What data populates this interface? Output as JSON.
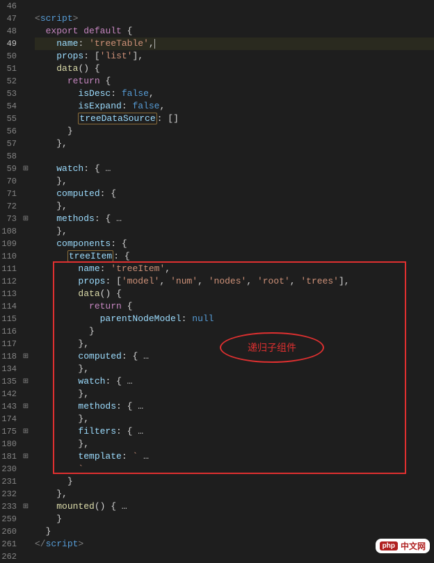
{
  "lines": [
    {
      "num": "46",
      "fold": "",
      "html": ""
    },
    {
      "num": "47",
      "fold": "",
      "html": "<span class='tag'>&lt;</span><span class='tagname'>script</span><span class='tag'>&gt;</span>"
    },
    {
      "num": "48",
      "fold": "",
      "html": "  <span class='kw-ctrl'>export</span> <span class='kw-ctrl'>default</span> <span class='brace'>{</span>"
    },
    {
      "num": "49",
      "fold": "",
      "hl": true,
      "html": "    <span class='prop'>name</span><span class='punc'>:</span> <span class='str'>'treeTable'</span><span class='punc'>,</span><span class='cursor'></span>"
    },
    {
      "num": "50",
      "fold": "",
      "html": "    <span class='prop'>props</span><span class='punc'>:</span> <span class='punc'>[</span><span class='str'>'list'</span><span class='punc'>],</span>"
    },
    {
      "num": "51",
      "fold": "",
      "html": "    <span class='fn'>data</span><span class='punc'>()</span> <span class='brace'>{</span>"
    },
    {
      "num": "52",
      "fold": "",
      "html": "      <span class='kw-ctrl'>return</span> <span class='brace'>{</span>"
    },
    {
      "num": "53",
      "fold": "",
      "html": "        <span class='prop'>isDesc</span><span class='punc'>:</span> <span class='bool'>false</span><span class='punc'>,</span>"
    },
    {
      "num": "54",
      "fold": "",
      "html": "        <span class='prop'>isExpand</span><span class='punc'>:</span> <span class='bool'>false</span><span class='punc'>,</span>"
    },
    {
      "num": "55",
      "fold": "",
      "html": "        <span class='prop underline-box'>treeDataSource</span><span class='punc'>:</span> <span class='punc'>[]</span>"
    },
    {
      "num": "56",
      "fold": "",
      "html": "      <span class='brace'>}</span>"
    },
    {
      "num": "57",
      "fold": "",
      "html": "    <span class='brace'>}</span><span class='punc'>,</span>"
    },
    {
      "num": "58",
      "fold": "",
      "html": ""
    },
    {
      "num": "59",
      "fold": "plus",
      "html": "    <span class='prop'>watch</span><span class='punc'>:</span> <span class='brace'>{</span><span class='punc'> …</span>"
    },
    {
      "num": "70",
      "fold": "",
      "html": "    <span class='brace'>}</span><span class='punc'>,</span>"
    },
    {
      "num": "71",
      "fold": "",
      "html": "    <span class='prop'>computed</span><span class='punc'>:</span> <span class='brace'>{</span>"
    },
    {
      "num": "72",
      "fold": "",
      "html": "    <span class='brace'>}</span><span class='punc'>,</span>"
    },
    {
      "num": "73",
      "fold": "plus",
      "html": "    <span class='prop'>methods</span><span class='punc'>:</span> <span class='brace'>{</span><span class='punc'> …</span>"
    },
    {
      "num": "108",
      "fold": "",
      "html": "    <span class='brace'>}</span><span class='punc'>,</span>"
    },
    {
      "num": "109",
      "fold": "",
      "html": "    <span class='prop'>components</span><span class='punc'>:</span> <span class='brace'>{</span>"
    },
    {
      "num": "110",
      "fold": "",
      "html": "      <span class='prop underline-box'>treeItem</span><span class='punc'>:</span> <span class='brace'>{</span>"
    },
    {
      "num": "111",
      "fold": "",
      "html": "        <span class='prop'>name</span><span class='punc'>:</span> <span class='str'>'treeItem'</span><span class='punc'>,</span>"
    },
    {
      "num": "112",
      "fold": "",
      "html": "        <span class='prop'>props</span><span class='punc'>:</span> <span class='punc'>[</span><span class='str'>'model'</span><span class='punc'>, </span><span class='str'>'num'</span><span class='punc'>, </span><span class='str'>'nodes'</span><span class='punc'>, </span><span class='str'>'root'</span><span class='punc'>, </span><span class='str'>'trees'</span><span class='punc'>],</span>"
    },
    {
      "num": "113",
      "fold": "",
      "html": "        <span class='fn'>data</span><span class='punc'>()</span> <span class='brace'>{</span>"
    },
    {
      "num": "114",
      "fold": "",
      "html": "          <span class='kw-ctrl'>return</span> <span class='brace'>{</span>"
    },
    {
      "num": "115",
      "fold": "",
      "html": "            <span class='prop'>parentNodeModel</span><span class='punc'>:</span> <span class='null'>null</span>"
    },
    {
      "num": "116",
      "fold": "",
      "html": "          <span class='brace'>}</span>"
    },
    {
      "num": "117",
      "fold": "",
      "html": "        <span class='brace'>}</span><span class='punc'>,</span>"
    },
    {
      "num": "118",
      "fold": "plus",
      "html": "        <span class='prop'>computed</span><span class='punc'>:</span> <span class='brace'>{</span><span class='punc'> …</span>"
    },
    {
      "num": "134",
      "fold": "",
      "html": "        <span class='brace'>}</span><span class='punc'>,</span>"
    },
    {
      "num": "135",
      "fold": "plus",
      "html": "        <span class='prop'>watch</span><span class='punc'>:</span> <span class='brace'>{</span><span class='punc'> …</span>"
    },
    {
      "num": "142",
      "fold": "",
      "html": "        <span class='brace'>}</span><span class='punc'>,</span>"
    },
    {
      "num": "143",
      "fold": "plus",
      "html": "        <span class='prop'>methods</span><span class='punc'>:</span> <span class='brace'>{</span><span class='punc'> …</span>"
    },
    {
      "num": "174",
      "fold": "",
      "html": "        <span class='brace'>}</span><span class='punc'>,</span>"
    },
    {
      "num": "175",
      "fold": "plus",
      "html": "        <span class='prop'>filters</span><span class='punc'>:</span> <span class='brace'>{</span><span class='punc'> …</span>"
    },
    {
      "num": "180",
      "fold": "",
      "html": "        <span class='brace'>}</span><span class='punc'>,</span>"
    },
    {
      "num": "181",
      "fold": "plus",
      "html": "        <span class='prop'>template</span><span class='punc'>:</span> <span class='str'>`</span><span class='punc'> …</span>"
    },
    {
      "num": "230",
      "fold": "",
      "html": "        <span class='str'>`</span>"
    },
    {
      "num": "231",
      "fold": "",
      "html": "      <span class='brace'>}</span>"
    },
    {
      "num": "232",
      "fold": "",
      "html": "    <span class='brace'>}</span><span class='punc'>,</span>"
    },
    {
      "num": "233",
      "fold": "plus",
      "html": "    <span class='fn'>mounted</span><span class='punc'>()</span> <span class='brace'>{</span><span class='punc'> …</span>"
    },
    {
      "num": "259",
      "fold": "",
      "html": "    <span class='brace'>}</span>"
    },
    {
      "num": "260",
      "fold": "",
      "html": "  <span class='brace'>}</span>"
    },
    {
      "num": "261",
      "fold": "",
      "html": "<span class='tag'>&lt;/</span><span class='tagname'>script</span><span class='tag'>&gt;</span>"
    },
    {
      "num": "262",
      "fold": "",
      "html": ""
    }
  ],
  "annotation": {
    "ellipse_text": "递归子组件"
  },
  "watermark": {
    "logo": "php",
    "text": "中文网"
  }
}
